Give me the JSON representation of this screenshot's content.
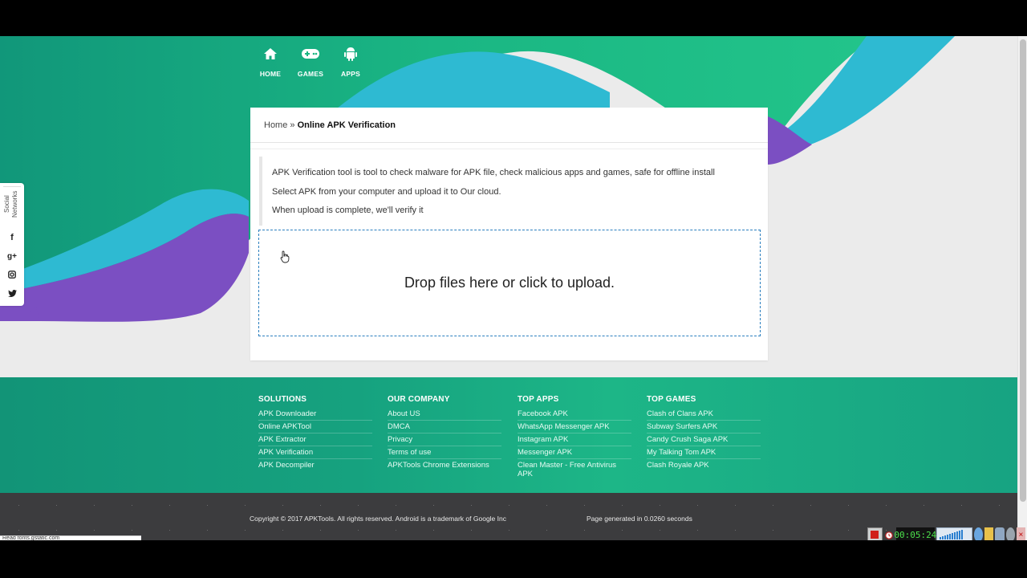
{
  "nav": [
    {
      "label": "HOME",
      "icon": "home-icon"
    },
    {
      "label": "GAMES",
      "icon": "gamepad-icon"
    },
    {
      "label": "APPS",
      "icon": "android-icon"
    }
  ],
  "social": {
    "title": "Social Networks",
    "items": [
      {
        "icon": "facebook-icon",
        "glyph": "f"
      },
      {
        "icon": "google-plus-icon",
        "glyph": "g+"
      },
      {
        "icon": "instagram-icon",
        "glyph": ""
      },
      {
        "icon": "twitter-icon",
        "glyph": ""
      }
    ]
  },
  "breadcrumb": {
    "home": "Home",
    "separator": " » ",
    "current": "Online APK Verification"
  },
  "info": [
    "APK Verification tool is tool to check malware for APK file, check malicious apps and games, safe for offline install",
    "Select APK from your computer and upload it to Our cloud.",
    "When upload is complete, we'll verify it"
  ],
  "dropzone": {
    "label": "Drop files here or click to upload."
  },
  "footer": {
    "columns": [
      {
        "title": "SOLUTIONS",
        "links": [
          "APK Downloader",
          "Online APKTool",
          "APK Extractor",
          "APK Verification",
          "APK Decompiler"
        ]
      },
      {
        "title": "OUR COMPANY",
        "links": [
          "About US",
          "DMCA",
          "Privacy",
          "Terms of use",
          "APKTools Chrome Extensions"
        ]
      },
      {
        "title": "TOP APPS",
        "links": [
          "Facebook APK",
          "WhatsApp Messenger APK",
          "Instagram APK",
          "Messenger APK",
          "Clean Master - Free Antivirus APK"
        ]
      },
      {
        "title": "TOP GAMES",
        "links": [
          "Clash of Clans APK",
          "Subway Surfers APK",
          "Candy Crush Saga APK",
          "My Talking Tom APK",
          "Clash Royale APK"
        ]
      }
    ],
    "copyright": "Copyright © 2017 APKTools. All rights reserved. Android is a trademark of Google Inc",
    "page_generated": "Page generated in 0.0260 seconds"
  },
  "status_text": "Read fonts.gstatic.com",
  "tray": {
    "clock": "00:05:24"
  },
  "colors": {
    "teal": "#1db687",
    "cyan": "#2ebad2",
    "purple": "#7b4fc2",
    "dropzone_border": "#2b7fbf"
  }
}
